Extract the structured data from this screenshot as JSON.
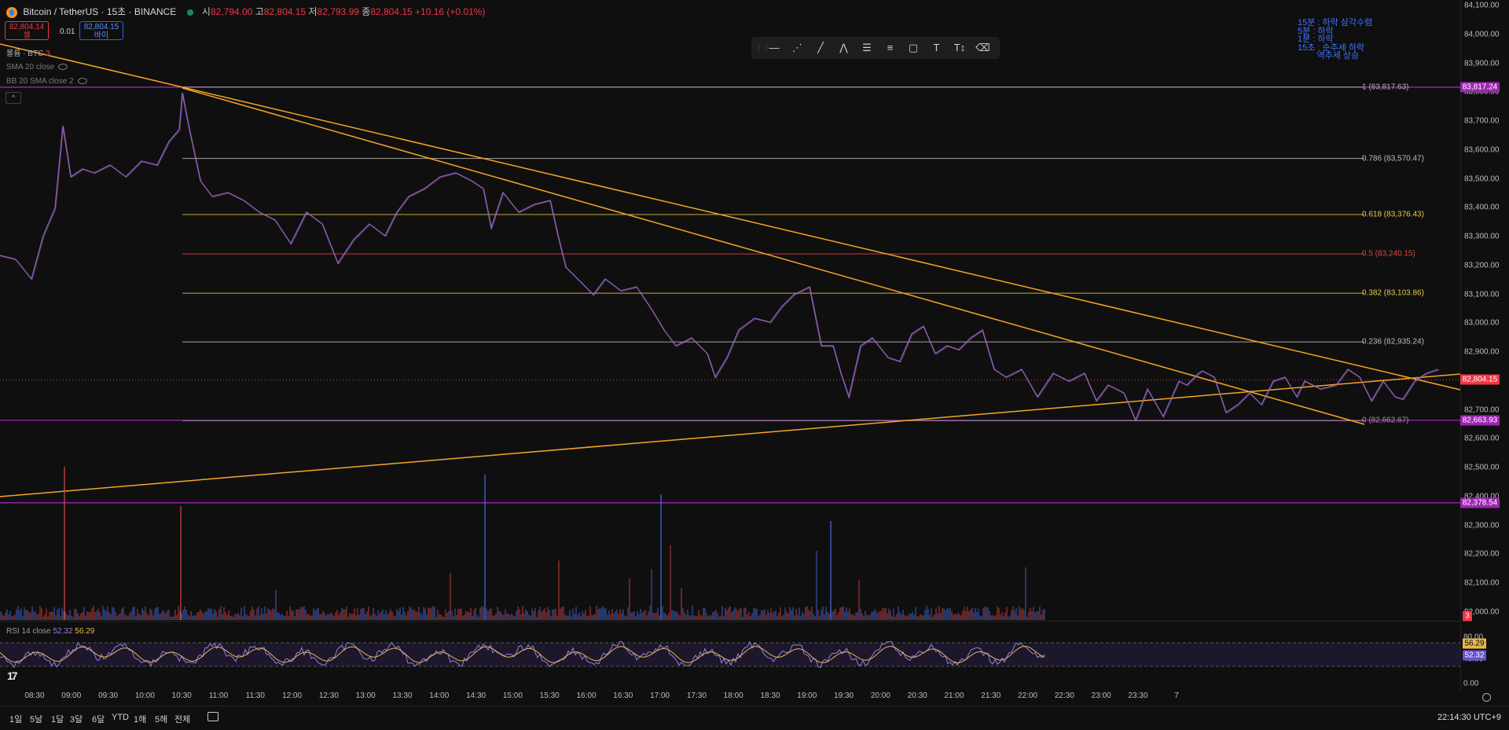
{
  "header": {
    "title": "Bitcoin / TetherUS · 15초 · BINANCE",
    "ohlc": [
      {
        "label": "시",
        "value": "82,794.00"
      },
      {
        "label": "고",
        "value": "82,804.15"
      },
      {
        "label": "저",
        "value": "82,793.99"
      },
      {
        "label": "종",
        "value": "82,804.15"
      }
    ],
    "change": "+10.16 (+0.01%)"
  },
  "trade": {
    "sell_price": "82,804.14",
    "sell_label": "셀",
    "spread": "0.01",
    "buy_price": "82,804.15",
    "buy_label": "바이"
  },
  "indicators": {
    "volume": "볼륨 · BTC",
    "volume_n": "3",
    "sma": "SMA 20 close",
    "bb": "BB 20 SMA close 2"
  },
  "toolbar": {
    "tools": [
      {
        "name": "horizontal-line-icon",
        "glyph": "—"
      },
      {
        "name": "pattern-icon",
        "glyph": "⋰"
      },
      {
        "name": "trendline-icon",
        "glyph": "╱"
      },
      {
        "name": "abcd-pattern-icon",
        "glyph": "⋀"
      },
      {
        "name": "parallel-channel-icon",
        "glyph": "☰"
      },
      {
        "name": "fib-channel-icon",
        "glyph": "≡"
      },
      {
        "name": "rectangle-icon",
        "glyph": "▢"
      },
      {
        "name": "text-icon",
        "glyph": "T"
      },
      {
        "name": "text-note-icon",
        "glyph": "T↕"
      },
      {
        "name": "eraser-icon",
        "glyph": "⌫"
      }
    ]
  },
  "annotation": [
    "15분 : 하락 삼각수렴",
    "5분 : 하락",
    "1분 : 하락",
    "15초 : 순추세 하락",
    "        역추세 상승"
  ],
  "price_scale": {
    "ticks": [
      "84,100.00",
      "84,000.00",
      "83,900.00",
      "83,800.00",
      "83,700.00",
      "83,600.00",
      "83,500.00",
      "83,400.00",
      "83,300.00",
      "83,200.00",
      "83,100.00",
      "83,000.00",
      "82,900.00",
      "82,800.00",
      "82,700.00",
      "82,600.00",
      "82,500.00",
      "82,400.00",
      "82,300.00",
      "82,200.00",
      "82,100.00",
      "82,000.00"
    ],
    "labels": [
      {
        "text": "83,817.24",
        "color": "#9c27b0",
        "price": 83817.24
      },
      {
        "text": "82,804.15",
        "color": "#f23645",
        "price": 82804.15
      },
      {
        "text": "82,663.93",
        "color": "#9c27b0",
        "price": 82663.93
      },
      {
        "text": "82,378.54",
        "color": "#9c27b0",
        "price": 82378.54
      }
    ],
    "volume_badge": "3"
  },
  "fib_levels": [
    {
      "label": "1 (83,817.63)",
      "price": 83817.63,
      "color": "#b0b0b0"
    },
    {
      "label": "0.786 (83,570.47)",
      "price": 83570.47,
      "color": "#bdbdbd"
    },
    {
      "label": "0.618 (83,376.43)",
      "price": 83376.43,
      "color": "#e6c84c"
    },
    {
      "label": "0.5 (83,240.15)",
      "price": 83240.15,
      "color": "#e04545"
    },
    {
      "label": "0.382 (83,103.86)",
      "price": 83103.86,
      "color": "#e6c84c"
    },
    {
      "label": "0.236 (82,935.24)",
      "price": 82935.24,
      "color": "#bdbdbd"
    },
    {
      "label": "0 (82,662.67)",
      "price": 82662.67,
      "color": "#9a9a9a"
    }
  ],
  "rsi": {
    "legend": "RSI 14 close",
    "value_a": "52.32",
    "value_b": "56.29",
    "scale": [
      "80.00",
      "40.00",
      "0.00"
    ],
    "badge_a": "56.29",
    "badge_b": "52.32"
  },
  "time_axis": [
    "08:30",
    "09:00",
    "09:30",
    "10:00",
    "10:30",
    "11:00",
    "11:30",
    "12:00",
    "12:30",
    "13:00",
    "13:30",
    "14:00",
    "14:30",
    "15:00",
    "15:30",
    "16:00",
    "16:30",
    "17:00",
    "17:30",
    "18:00",
    "18:30",
    "19:00",
    "19:30",
    "20:00",
    "20:30",
    "21:00",
    "21:30",
    "22:00",
    "22:30",
    "23:00",
    "23:30",
    "7"
  ],
  "bottom": {
    "ranges": [
      "1일",
      "5날",
      "1달",
      "3달",
      "6달",
      "YTD",
      "1해",
      "5해",
      "전체"
    ],
    "clock": "22:14:30 UTC+9"
  },
  "colors": {
    "up": "#f23645",
    "down": "#2962ff",
    "trend": "#f5a623",
    "purple": "#9c27b0"
  }
}
